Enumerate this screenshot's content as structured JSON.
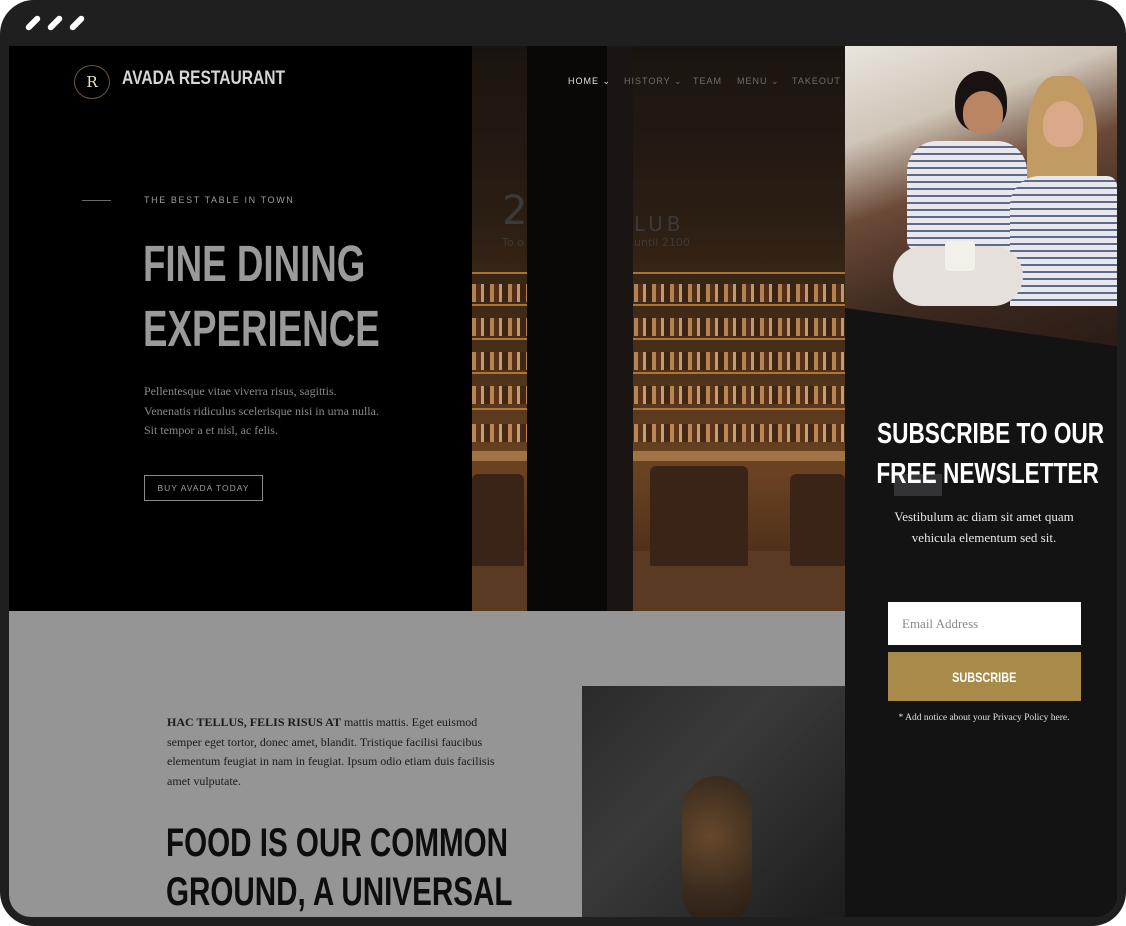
{
  "site": {
    "brand": "AVADA RESTAURANT",
    "logo_letter": "R"
  },
  "nav": {
    "items": [
      {
        "label": "HOME",
        "active": true
      },
      {
        "label": "HISTORY",
        "active": false
      },
      {
        "label": "TEAM",
        "active": false
      },
      {
        "label": "MENU",
        "active": false
      },
      {
        "label": "TAKEOUT",
        "active": false
      }
    ]
  },
  "hero": {
    "tagline": "THE BEST TABLE IN TOWN",
    "title_line1": "FINE DINING",
    "title_line2": "EXPERIENCE",
    "lead": "Pellentesque vitae viverra risus, sagittis. Venenatis ridiculus scelerisque nisi in urna nulla. Sit tempor a et nisl, ac felis.",
    "cta_label": "BUY AVADA TODAY",
    "sign_number": "2",
    "sign_word": "LUB",
    "sign_left": "To o",
    "sign_right": "until 2100"
  },
  "lower": {
    "lead_bold": "HAC TELLUS, FELIS RISUS AT",
    "lead_rest": " mattis mattis. Eget euismod semper eget tortor, donec amet, blandit. Tristique facilisi faucibus elementum feugiat in nam in feugiat. Ipsum odio etiam duis facilisis amet vulputate.",
    "heading_line1": "FOOD IS OUR COMMON",
    "heading_line2": "GROUND, A UNIVERSAL"
  },
  "newsletter": {
    "title_line1": "SUBSCRIBE TO OUR",
    "title_line2": "FREE NEWSLETTER",
    "description": "Vestibulum ac diam sit amet quam vehicula elementum sed sit.",
    "email_placeholder": "Email Address",
    "subscribe_label": "SUBSCRIBE",
    "notice": "* Add notice about your Privacy Policy here."
  },
  "colors": {
    "accent_gold": "#a88b4a",
    "panel_bg": "#131314",
    "hero_bg": "#000000",
    "lower_bg": "#959595"
  }
}
